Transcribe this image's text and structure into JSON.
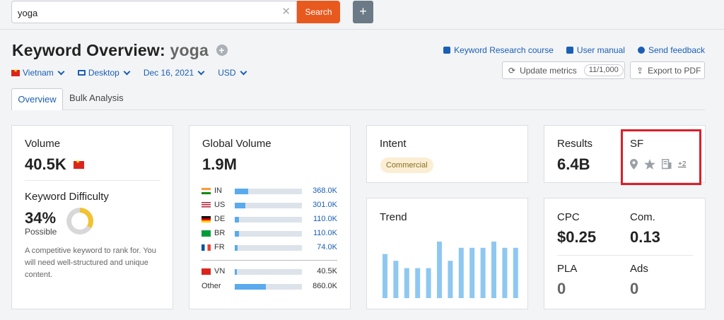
{
  "search": {
    "value": "yoga",
    "button": "Search",
    "add_button": "+"
  },
  "header": {
    "title_prefix": "Keyword Overview:",
    "keyword": "yoga",
    "title_plus": "+"
  },
  "filters": {
    "country": "Vietnam",
    "device": "Desktop",
    "date": "Dec 16, 2021",
    "currency": "USD"
  },
  "links": {
    "course": "Keyword Research course",
    "manual": "User manual",
    "feedback": "Send feedback"
  },
  "buttons": {
    "update": "Update metrics",
    "update_count": "11/1,000",
    "export": "Export to PDF"
  },
  "tabs": {
    "overview": "Overview",
    "bulk": "Bulk Analysis"
  },
  "volume": {
    "title": "Volume",
    "value": "40.5K",
    "kd_title": "Keyword Difficulty",
    "kd_value": "34%",
    "kd_percent": 34,
    "kd_label": "Possible",
    "description": "A competitive keyword to rank for. You will need well-structured and unique content."
  },
  "global": {
    "title": "Global Volume",
    "value": "1.9M",
    "countries": [
      {
        "code": "IN",
        "value": "368.0K",
        "share": 0.2
      },
      {
        "code": "US",
        "value": "301.0K",
        "share": 0.16
      },
      {
        "code": "DE",
        "value": "110.0K",
        "share": 0.06
      },
      {
        "code": "BR",
        "value": "110.0K",
        "share": 0.06
      },
      {
        "code": "FR",
        "value": "74.0K",
        "share": 0.04
      }
    ],
    "local": {
      "code": "VN",
      "value": "40.5K",
      "share": 0.02
    },
    "other": {
      "code": "Other",
      "value": "860.0K",
      "share": 0.46
    }
  },
  "intent": {
    "title": "Intent",
    "badge": "Commercial"
  },
  "trend": {
    "title": "Trend",
    "bars": [
      0.78,
      0.66,
      0.53,
      0.53,
      0.53,
      1.0,
      0.66,
      0.89,
      0.89,
      0.89,
      1.0,
      0.89,
      0.89
    ]
  },
  "results": {
    "title": "Results",
    "value": "6.4B"
  },
  "sf": {
    "title": "SF",
    "more": "+2",
    "icons": [
      "location-pin-icon",
      "star-icon",
      "image-pack-icon"
    ]
  },
  "cpc": {
    "title": "CPC",
    "value": "$0.25",
    "com_title": "Com.",
    "com_value": "0.13",
    "pla_title": "PLA",
    "pla_value": "0",
    "ads_title": "Ads",
    "ads_value": "0"
  },
  "colors": {
    "accent": "#1a5fb4",
    "search_button": "#e8591e",
    "bar": "#5aaaee",
    "trend_bar": "#8ec8f0",
    "highlight": "#d9202a",
    "kd": "#f1c232"
  }
}
